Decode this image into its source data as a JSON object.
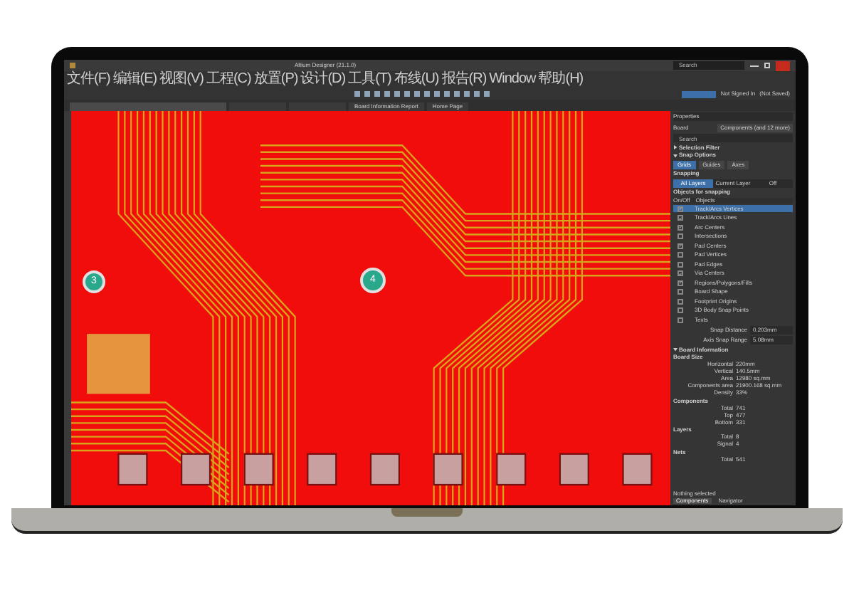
{
  "window": {
    "title": "Altium Designer (21.1.0)",
    "search": {
      "placeholder": "Search"
    },
    "account": "Not Signed In",
    "save_state": "(Not Saved)"
  },
  "menu": [
    "文件(F)",
    "编辑(E)",
    "视图(V)",
    "工程(C)",
    "放置(P)",
    "设计(D)",
    "工具(T)",
    "布线(U)",
    "报告(R)",
    "Window",
    "帮助(H)"
  ],
  "tabs": [
    {
      "label": "Board Information Report",
      "selected": false
    },
    {
      "label": "Home Page",
      "selected": false
    }
  ],
  "canvas": {
    "markers": [
      "3",
      "4"
    ]
  },
  "properties": {
    "title": "Properties",
    "context": "Board",
    "filter": "Components (and 12 more)",
    "search": {
      "placeholder": "Search"
    },
    "sections": [
      {
        "label": "Selection Filter",
        "expanded": false
      },
      {
        "label": "Snap Options",
        "expanded": true
      }
    ],
    "snap_tabs": [
      {
        "label": "Grids",
        "selected": true
      },
      {
        "label": "Guides",
        "selected": false
      },
      {
        "label": "Axes",
        "selected": false
      }
    ],
    "snapping_label": "Snapping",
    "snapping": [
      {
        "label": "All Layers",
        "selected": true
      },
      {
        "label": "Current Layer",
        "selected": false
      },
      {
        "label": "Off",
        "selected": false
      }
    ],
    "objects_label": "Objects for snapping",
    "objects_columns": [
      "On/Off",
      "Objects"
    ],
    "objects": [
      {
        "label": "Track/Arcs Vertices",
        "checked": true,
        "selected": true
      },
      {
        "label": "Track/Arcs Lines",
        "checked": true,
        "selected": false
      },
      {
        "label": "Arc Centers",
        "checked": true,
        "selected": false
      },
      {
        "label": "Intersections",
        "checked": false,
        "selected": false
      },
      {
        "label": "Pad Centers",
        "checked": true,
        "selected": false
      },
      {
        "label": "Pad Vertices",
        "checked": false,
        "selected": false
      },
      {
        "label": "Pad Edges",
        "checked": false,
        "selected": false
      },
      {
        "label": "Via Centers",
        "checked": true,
        "selected": false
      },
      {
        "label": "Regions/Polygons/Fills",
        "checked": true,
        "selected": false
      },
      {
        "label": "Board Shape",
        "checked": false,
        "selected": false
      },
      {
        "label": "Footprint Origins",
        "checked": false,
        "selected": false
      },
      {
        "label": "3D Body Snap Points",
        "checked": false,
        "selected": false
      },
      {
        "label": "Texts",
        "checked": false,
        "selected": false
      }
    ],
    "fields": [
      {
        "label": "Snap Distance",
        "value": "0.203mm"
      },
      {
        "label": "Axis Snap Range",
        "value": "5.08mm"
      }
    ],
    "board_info": {
      "label": "Board Information",
      "expanded": true,
      "groups": [
        {
          "title": "Board Size",
          "rows": [
            {
              "label": "Horizontal",
              "value": "220mm"
            },
            {
              "label": "Vertical",
              "value": "140.5mm"
            },
            {
              "label": "Area",
              "value": "12980 sq.mm"
            },
            {
              "label": "Components area",
              "value": "21900.168 sq.mm"
            },
            {
              "label": "Density",
              "value": "33%"
            }
          ]
        },
        {
          "title": "Components",
          "rows": [
            {
              "label": "Total",
              "value": "741"
            },
            {
              "label": "Top",
              "value": "477"
            },
            {
              "label": "Bottom",
              "value": "331"
            }
          ]
        },
        {
          "title": "Layers",
          "rows": [
            {
              "label": "Total",
              "value": "8"
            },
            {
              "label": "Signal",
              "value": "4"
            }
          ]
        },
        {
          "title": "Nets",
          "rows": [
            {
              "label": "Total",
              "value": "541"
            }
          ]
        }
      ]
    },
    "status": "Nothing selected",
    "bottom_tabs": [
      {
        "label": "Components",
        "selected": true
      },
      {
        "label": "Navigator",
        "selected": false
      }
    ]
  }
}
